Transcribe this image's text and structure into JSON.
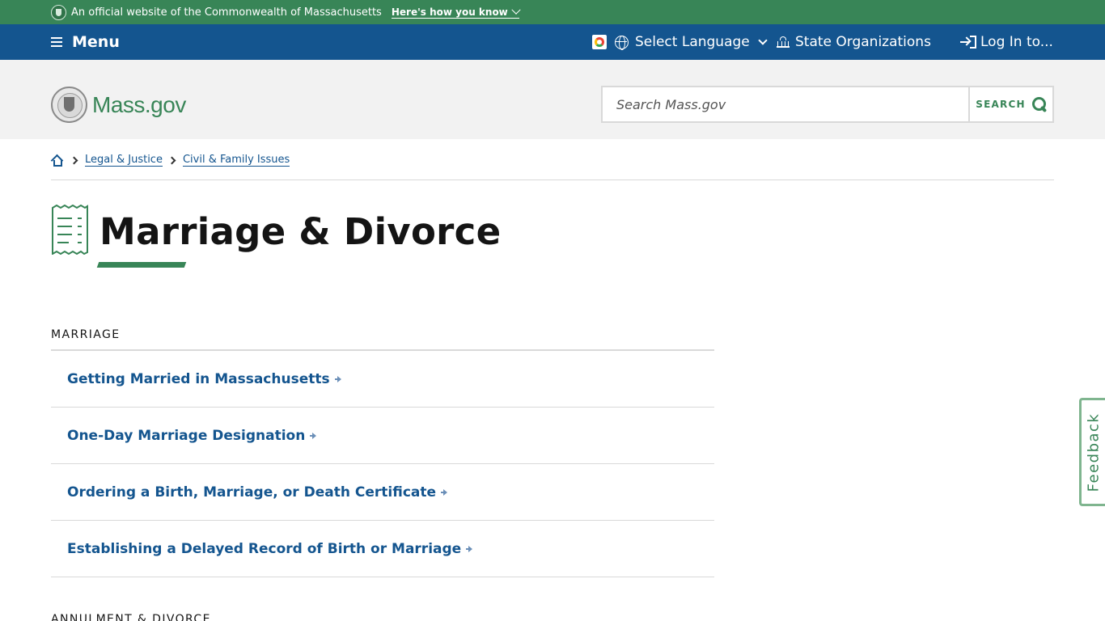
{
  "official_banner": {
    "text": "An official website of the Commonwealth of Massachusetts",
    "howto": "Here's how you know"
  },
  "utility_nav": {
    "menu": "Menu",
    "language": "Select Language",
    "orgs": "State Organizations",
    "login": "Log In to..."
  },
  "header": {
    "logo": "Mass.gov",
    "search_placeholder": "Search Mass.gov",
    "search_button": "SEARCH"
  },
  "breadcrumb": {
    "items": [
      "Legal & Justice",
      "Civil & Family Issues"
    ]
  },
  "page": {
    "title": "Marriage & Divorce"
  },
  "sections": [
    {
      "heading": "MARRIAGE",
      "links": [
        "Getting Married in Massachusetts",
        "One-Day Marriage Designation",
        "Ordering a Birth, Marriage, or Death Certificate",
        "Establishing a Delayed Record of Birth or Marriage"
      ]
    },
    {
      "heading": "ANNULMENT & DIVORCE"
    }
  ],
  "feedback": "Feedback",
  "colors": {
    "green": "#388557",
    "blue": "#14558f",
    "header_bg": "#f2f2f2"
  }
}
